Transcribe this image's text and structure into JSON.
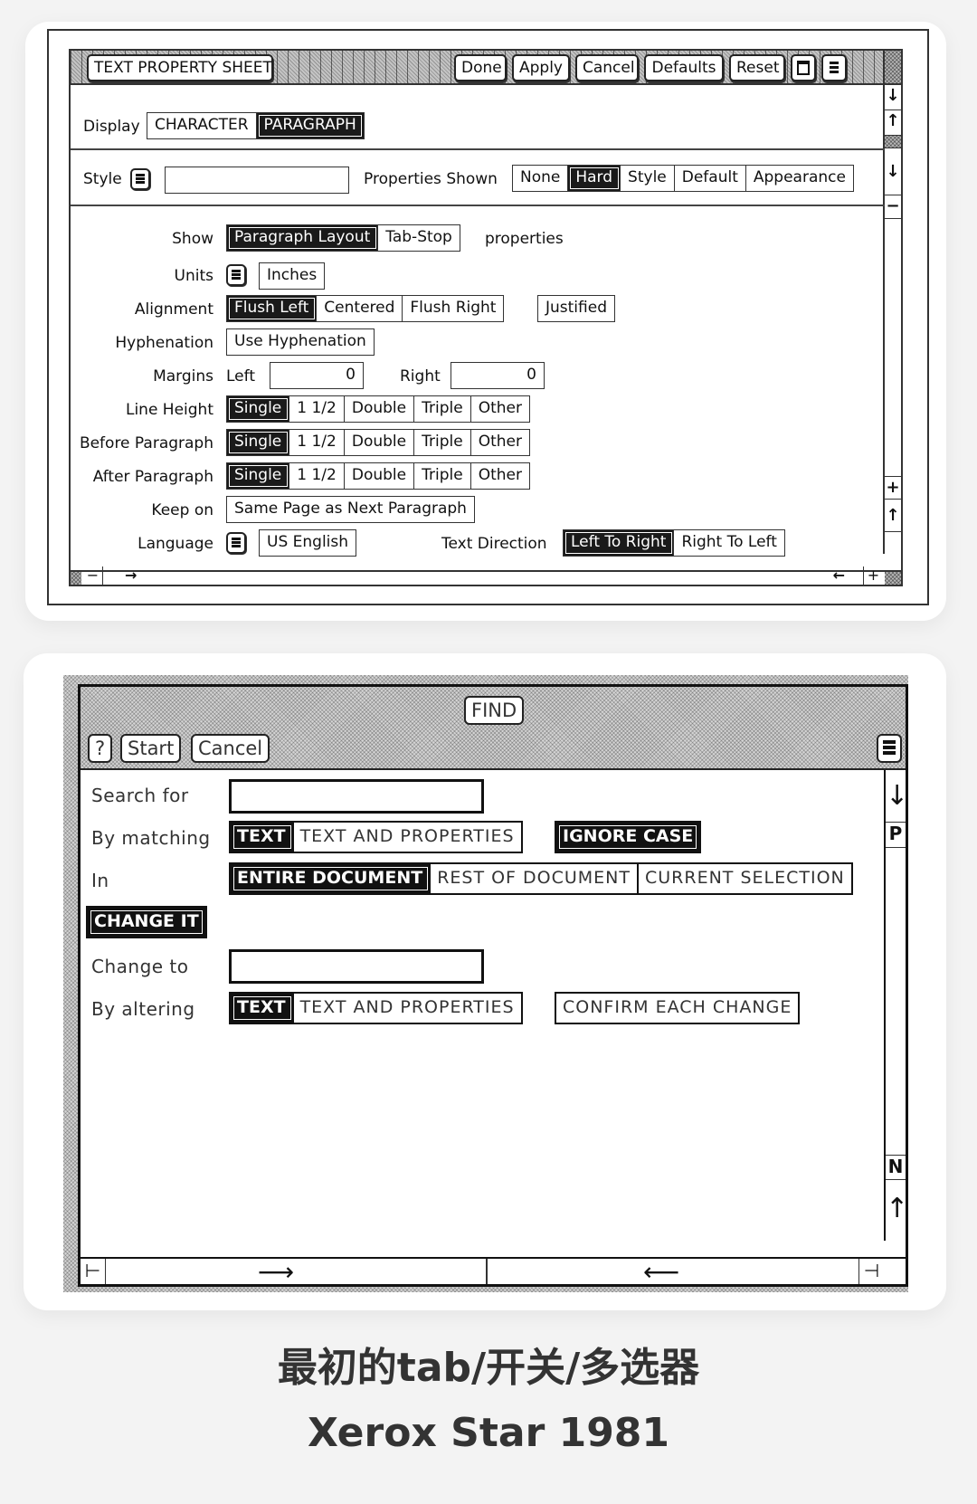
{
  "property_sheet": {
    "title": "TEXT PROPERTY SHEET",
    "header_buttons": [
      "Done",
      "Apply",
      "Cancel",
      "Defaults",
      "Reset"
    ],
    "header_icons": [
      "window-icon",
      "menu-icon"
    ],
    "display": {
      "label": "Display",
      "options": [
        "CHARACTER",
        "PARAGRAPH"
      ],
      "selected": "PARAGRAPH"
    },
    "style": {
      "label": "Style",
      "value": ""
    },
    "properties_shown": {
      "label": "Properties Shown",
      "options": [
        "None",
        "Hard",
        "Style",
        "Default",
        "Appearance"
      ],
      "selected": "Hard"
    },
    "show": {
      "label": "Show",
      "options": [
        "Paragraph Layout",
        "Tab-Stop"
      ],
      "selected": "Paragraph Layout",
      "suffix": "properties"
    },
    "units": {
      "label": "Units",
      "value": "Inches"
    },
    "alignment": {
      "label": "Alignment",
      "options": [
        "Flush Left",
        "Centered",
        "Flush Right"
      ],
      "selected": "Flush Left",
      "extra": "Justified"
    },
    "hyphenation": {
      "label": "Hyphenation",
      "option": "Use Hyphenation"
    },
    "margins": {
      "label": "Margins",
      "left_label": "Left",
      "left_value": "0",
      "right_label": "Right",
      "right_value": "0"
    },
    "line_height": {
      "label": "Line Height",
      "options": [
        "Single",
        "1 1/2",
        "Double",
        "Triple",
        "Other"
      ],
      "selected": "Single"
    },
    "before_paragraph": {
      "label": "Before Paragraph",
      "options": [
        "Single",
        "1 1/2",
        "Double",
        "Triple",
        "Other"
      ],
      "selected": "Single"
    },
    "after_paragraph": {
      "label": "After Paragraph",
      "options": [
        "Single",
        "1 1/2",
        "Double",
        "Triple",
        "Other"
      ],
      "selected": "Single"
    },
    "keep_on": {
      "label": "Keep on",
      "option": "Same Page as Next Paragraph"
    },
    "language": {
      "label": "Language",
      "value": "US English"
    },
    "text_direction": {
      "label": "Text Direction",
      "options": [
        "Left To Right",
        "Right To Left"
      ],
      "selected": "Left To Right"
    },
    "scrollbar_glyphs": {
      "down": "↓",
      "up": "↑",
      "minus": "−",
      "plus": "+",
      "right": "→",
      "left": "←"
    }
  },
  "find_window": {
    "title": "FIND",
    "buttons": [
      "?",
      "Start",
      "Cancel"
    ],
    "search_for": {
      "label": "Search for",
      "value": ""
    },
    "by_matching": {
      "label": "By matching",
      "options": [
        "TEXT",
        "TEXT AND PROPERTIES"
      ],
      "selected": "TEXT"
    },
    "ignore_case": {
      "label": "IGNORE CASE",
      "on": true
    },
    "in": {
      "label": "In",
      "options": [
        "ENTIRE DOCUMENT",
        "REST OF DOCUMENT",
        "CURRENT SELECTION"
      ],
      "selected": "ENTIRE DOCUMENT"
    },
    "change_it": {
      "label": "CHANGE IT",
      "on": true
    },
    "change_to": {
      "label": "Change to",
      "value": ""
    },
    "by_altering": {
      "label": "By altering",
      "options": [
        "TEXT",
        "TEXT AND PROPERTIES"
      ],
      "selected": "TEXT"
    },
    "confirm_each_change": {
      "label": "CONFIRM EACH CHANGE",
      "on": false
    },
    "scrollbar_glyphs": {
      "down": "↓",
      "page": "P",
      "next": "N",
      "up": "↑",
      "right": "⟶",
      "left": "⟵",
      "start": "⊢",
      "end": "⊣"
    }
  },
  "caption": {
    "line1": "最初的tab/开关/多选器",
    "line2": "Xerox Star 1981"
  }
}
